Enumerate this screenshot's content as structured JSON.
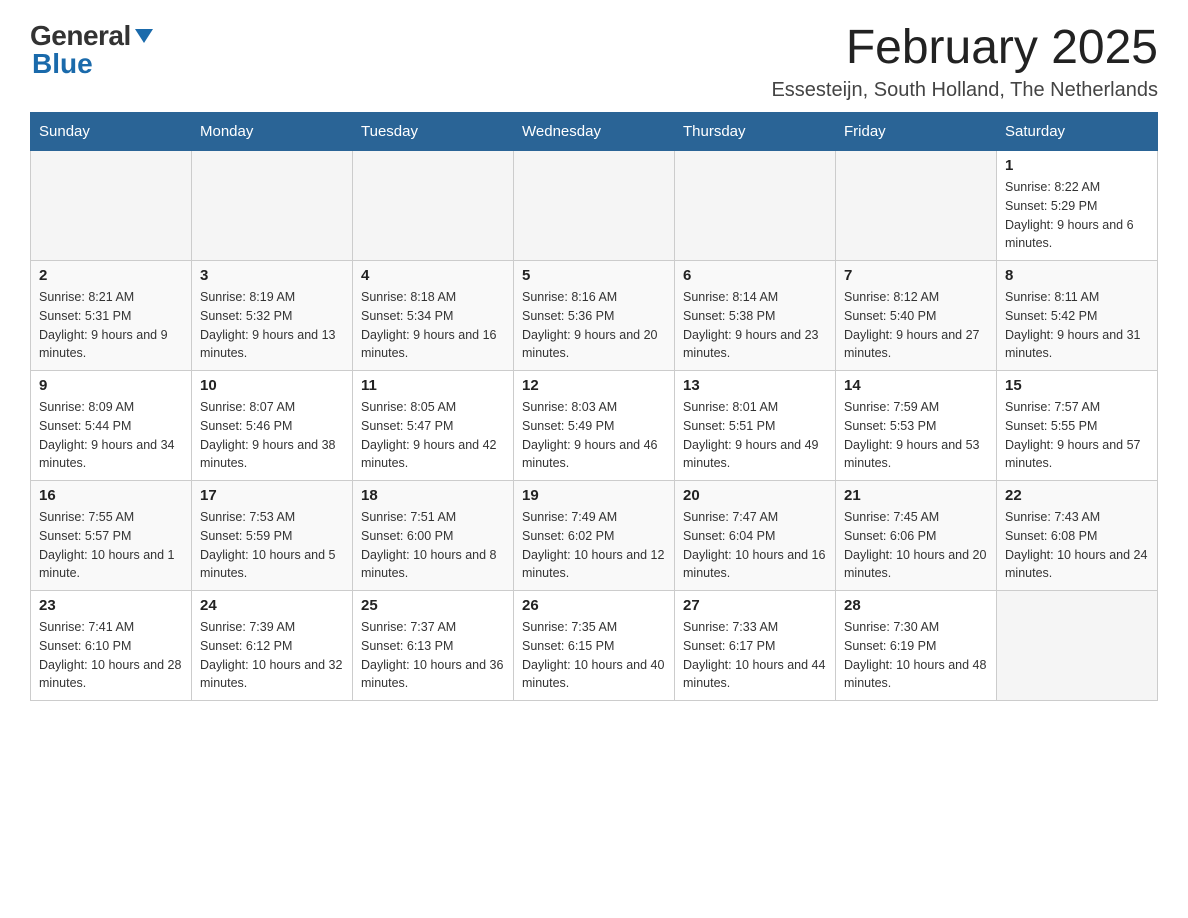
{
  "header": {
    "logo_general": "General",
    "logo_blue": "Blue",
    "month_title": "February 2025",
    "location": "Essesteijn, South Holland, The Netherlands"
  },
  "days_of_week": [
    "Sunday",
    "Monday",
    "Tuesday",
    "Wednesday",
    "Thursday",
    "Friday",
    "Saturday"
  ],
  "weeks": [
    {
      "days": [
        {
          "number": "",
          "info": ""
        },
        {
          "number": "",
          "info": ""
        },
        {
          "number": "",
          "info": ""
        },
        {
          "number": "",
          "info": ""
        },
        {
          "number": "",
          "info": ""
        },
        {
          "number": "",
          "info": ""
        },
        {
          "number": "1",
          "info": "Sunrise: 8:22 AM\nSunset: 5:29 PM\nDaylight: 9 hours and 6 minutes."
        }
      ]
    },
    {
      "days": [
        {
          "number": "2",
          "info": "Sunrise: 8:21 AM\nSunset: 5:31 PM\nDaylight: 9 hours and 9 minutes."
        },
        {
          "number": "3",
          "info": "Sunrise: 8:19 AM\nSunset: 5:32 PM\nDaylight: 9 hours and 13 minutes."
        },
        {
          "number": "4",
          "info": "Sunrise: 8:18 AM\nSunset: 5:34 PM\nDaylight: 9 hours and 16 minutes."
        },
        {
          "number": "5",
          "info": "Sunrise: 8:16 AM\nSunset: 5:36 PM\nDaylight: 9 hours and 20 minutes."
        },
        {
          "number": "6",
          "info": "Sunrise: 8:14 AM\nSunset: 5:38 PM\nDaylight: 9 hours and 23 minutes."
        },
        {
          "number": "7",
          "info": "Sunrise: 8:12 AM\nSunset: 5:40 PM\nDaylight: 9 hours and 27 minutes."
        },
        {
          "number": "8",
          "info": "Sunrise: 8:11 AM\nSunset: 5:42 PM\nDaylight: 9 hours and 31 minutes."
        }
      ]
    },
    {
      "days": [
        {
          "number": "9",
          "info": "Sunrise: 8:09 AM\nSunset: 5:44 PM\nDaylight: 9 hours and 34 minutes."
        },
        {
          "number": "10",
          "info": "Sunrise: 8:07 AM\nSunset: 5:46 PM\nDaylight: 9 hours and 38 minutes."
        },
        {
          "number": "11",
          "info": "Sunrise: 8:05 AM\nSunset: 5:47 PM\nDaylight: 9 hours and 42 minutes."
        },
        {
          "number": "12",
          "info": "Sunrise: 8:03 AM\nSunset: 5:49 PM\nDaylight: 9 hours and 46 minutes."
        },
        {
          "number": "13",
          "info": "Sunrise: 8:01 AM\nSunset: 5:51 PM\nDaylight: 9 hours and 49 minutes."
        },
        {
          "number": "14",
          "info": "Sunrise: 7:59 AM\nSunset: 5:53 PM\nDaylight: 9 hours and 53 minutes."
        },
        {
          "number": "15",
          "info": "Sunrise: 7:57 AM\nSunset: 5:55 PM\nDaylight: 9 hours and 57 minutes."
        }
      ]
    },
    {
      "days": [
        {
          "number": "16",
          "info": "Sunrise: 7:55 AM\nSunset: 5:57 PM\nDaylight: 10 hours and 1 minute."
        },
        {
          "number": "17",
          "info": "Sunrise: 7:53 AM\nSunset: 5:59 PM\nDaylight: 10 hours and 5 minutes."
        },
        {
          "number": "18",
          "info": "Sunrise: 7:51 AM\nSunset: 6:00 PM\nDaylight: 10 hours and 8 minutes."
        },
        {
          "number": "19",
          "info": "Sunrise: 7:49 AM\nSunset: 6:02 PM\nDaylight: 10 hours and 12 minutes."
        },
        {
          "number": "20",
          "info": "Sunrise: 7:47 AM\nSunset: 6:04 PM\nDaylight: 10 hours and 16 minutes."
        },
        {
          "number": "21",
          "info": "Sunrise: 7:45 AM\nSunset: 6:06 PM\nDaylight: 10 hours and 20 minutes."
        },
        {
          "number": "22",
          "info": "Sunrise: 7:43 AM\nSunset: 6:08 PM\nDaylight: 10 hours and 24 minutes."
        }
      ]
    },
    {
      "days": [
        {
          "number": "23",
          "info": "Sunrise: 7:41 AM\nSunset: 6:10 PM\nDaylight: 10 hours and 28 minutes."
        },
        {
          "number": "24",
          "info": "Sunrise: 7:39 AM\nSunset: 6:12 PM\nDaylight: 10 hours and 32 minutes."
        },
        {
          "number": "25",
          "info": "Sunrise: 7:37 AM\nSunset: 6:13 PM\nDaylight: 10 hours and 36 minutes."
        },
        {
          "number": "26",
          "info": "Sunrise: 7:35 AM\nSunset: 6:15 PM\nDaylight: 10 hours and 40 minutes."
        },
        {
          "number": "27",
          "info": "Sunrise: 7:33 AM\nSunset: 6:17 PM\nDaylight: 10 hours and 44 minutes."
        },
        {
          "number": "28",
          "info": "Sunrise: 7:30 AM\nSunset: 6:19 PM\nDaylight: 10 hours and 48 minutes."
        },
        {
          "number": "",
          "info": ""
        }
      ]
    }
  ]
}
